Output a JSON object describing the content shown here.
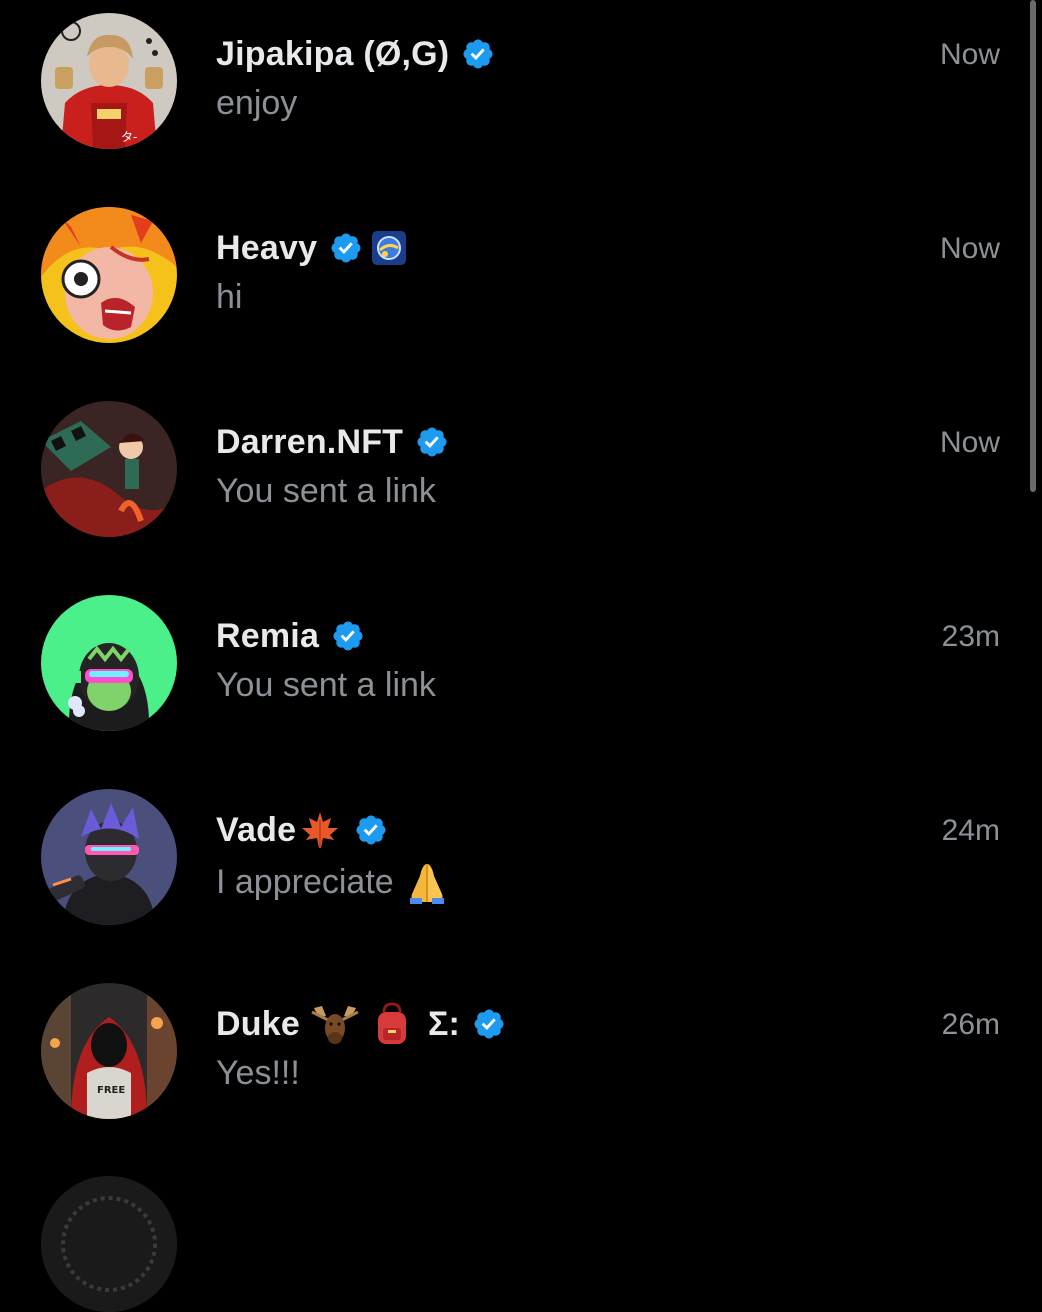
{
  "conversations": [
    {
      "name": "Jipakipa (Ø,G)",
      "verified": true,
      "emojis": [],
      "preview": "enjoy",
      "time": "Now"
    },
    {
      "name": "Heavy",
      "verified": true,
      "emojis": [
        "globe-badge"
      ],
      "preview": "hi",
      "time": "Now"
    },
    {
      "name": "Darren.NFT",
      "verified": true,
      "emojis": [],
      "preview": "You sent a link",
      "time": "Now"
    },
    {
      "name": "Remia",
      "verified": true,
      "emojis": [],
      "preview": "You sent a link",
      "time": "23m"
    },
    {
      "name": "Vade",
      "verified": true,
      "emojis": [
        "maple-leaf"
      ],
      "preview": "I appreciate",
      "preview_emoji": "folded-hands",
      "time": "24m"
    },
    {
      "name": "Duke",
      "verified": true,
      "emojis": [
        "moose",
        "backpack"
      ],
      "name_suffix": "Σ:",
      "preview": "Yes!!!",
      "time": "26m"
    }
  ],
  "colors": {
    "background": "#000000",
    "name_text": "#e7e9ea",
    "secondary_text": "#8b9196",
    "verified_badge": "#1d9bf0"
  },
  "icons": {
    "verified": "verified-badge-icon"
  }
}
